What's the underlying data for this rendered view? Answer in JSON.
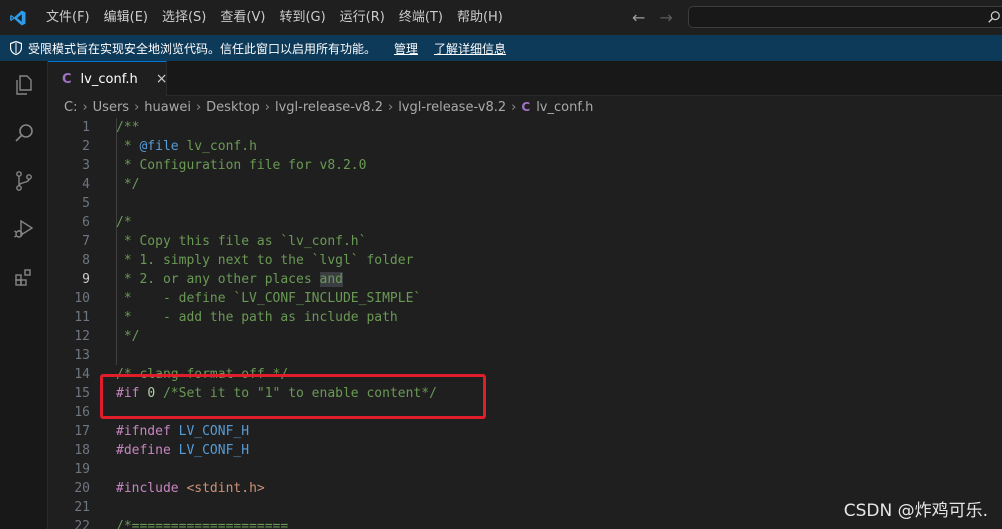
{
  "titlebar": {
    "menu": [
      "文件(F)",
      "编辑(E)",
      "选择(S)",
      "查看(V)",
      "转到(G)",
      "运行(R)",
      "终端(T)",
      "帮助(H)"
    ],
    "search_label": "搜"
  },
  "banner": {
    "message": "受限模式旨在实现安全地浏览代码。信任此窗口以启用所有功能。",
    "manage_link": "管理",
    "learn_more_link": "了解详细信息",
    "background": "#0e3a5a"
  },
  "activity_icons": [
    "explorer-icon",
    "search-icon",
    "source-control-icon",
    "run-debug-icon",
    "extensions-icon"
  ],
  "tab": {
    "icon": "C",
    "label": "lv_conf.h",
    "close": "×"
  },
  "breadcrumb": [
    "C:",
    "Users",
    "huawei",
    "Desktop",
    "lvgl-release-v8.2",
    "lvgl-release-v8.2",
    "lv_conf.h"
  ],
  "editor": {
    "current_line": 9,
    "lines": [
      {
        "n": "1",
        "code": [
          {
            "t": "/**",
            "c": "comment"
          }
        ]
      },
      {
        "n": "2",
        "code": [
          {
            "t": " * ",
            "c": "comment"
          },
          {
            "t": "@file",
            "c": "doc"
          },
          {
            "t": " lv_conf.h",
            "c": "comment"
          }
        ]
      },
      {
        "n": "3",
        "code": [
          {
            "t": " * Configuration file for v8.2.0",
            "c": "comment"
          }
        ]
      },
      {
        "n": "4",
        "code": [
          {
            "t": " */",
            "c": "comment"
          }
        ]
      },
      {
        "n": "5",
        "code": []
      },
      {
        "n": "6",
        "code": [
          {
            "t": "/*",
            "c": "comment"
          }
        ]
      },
      {
        "n": "7",
        "code": [
          {
            "t": " * Copy this file as `lv_conf.h`",
            "c": "comment"
          }
        ]
      },
      {
        "n": "8",
        "code": [
          {
            "t": " * 1. simply next to the `lvgl` folder",
            "c": "comment"
          }
        ]
      },
      {
        "n": "9",
        "code": [
          {
            "t": " * 2. or any other places ",
            "c": "comment"
          },
          {
            "t": "and",
            "c": "comment-hl"
          }
        ]
      },
      {
        "n": "10",
        "code": [
          {
            "t": " *    - define `LV_CONF_INCLUDE_SIMPLE`",
            "c": "comment"
          }
        ]
      },
      {
        "n": "11",
        "code": [
          {
            "t": " *    - add the path as include path",
            "c": "comment"
          }
        ]
      },
      {
        "n": "12",
        "code": [
          {
            "t": " */",
            "c": "comment"
          }
        ]
      },
      {
        "n": "13",
        "code": []
      },
      {
        "n": "14",
        "code": [
          {
            "t": "/* clang-format off */",
            "c": "comment"
          }
        ]
      },
      {
        "n": "15",
        "code": [
          {
            "t": "#if",
            "c": "dir"
          },
          {
            "t": " ",
            "c": "plain"
          },
          {
            "t": "0",
            "c": "num"
          },
          {
            "t": " /*Set it to \"1\" to enable content*/",
            "c": "comment"
          }
        ]
      },
      {
        "n": "16",
        "code": []
      },
      {
        "n": "17",
        "code": [
          {
            "t": "#ifndef",
            "c": "dir"
          },
          {
            "t": " LV_CONF_H",
            "c": "ident"
          }
        ]
      },
      {
        "n": "18",
        "code": [
          {
            "t": "#define",
            "c": "dir"
          },
          {
            "t": " LV_CONF_H",
            "c": "ident"
          }
        ]
      },
      {
        "n": "19",
        "code": []
      },
      {
        "n": "20",
        "code": [
          {
            "t": "#include",
            "c": "dir"
          },
          {
            "t": " ",
            "c": "plain"
          },
          {
            "t": "<stdint.h>",
            "c": "str"
          }
        ]
      },
      {
        "n": "21",
        "code": []
      },
      {
        "n": "22",
        "code": [
          {
            "t": "/*====================",
            "c": "comment"
          }
        ]
      }
    ]
  },
  "watermark": "CSDN @炸鸡可乐."
}
